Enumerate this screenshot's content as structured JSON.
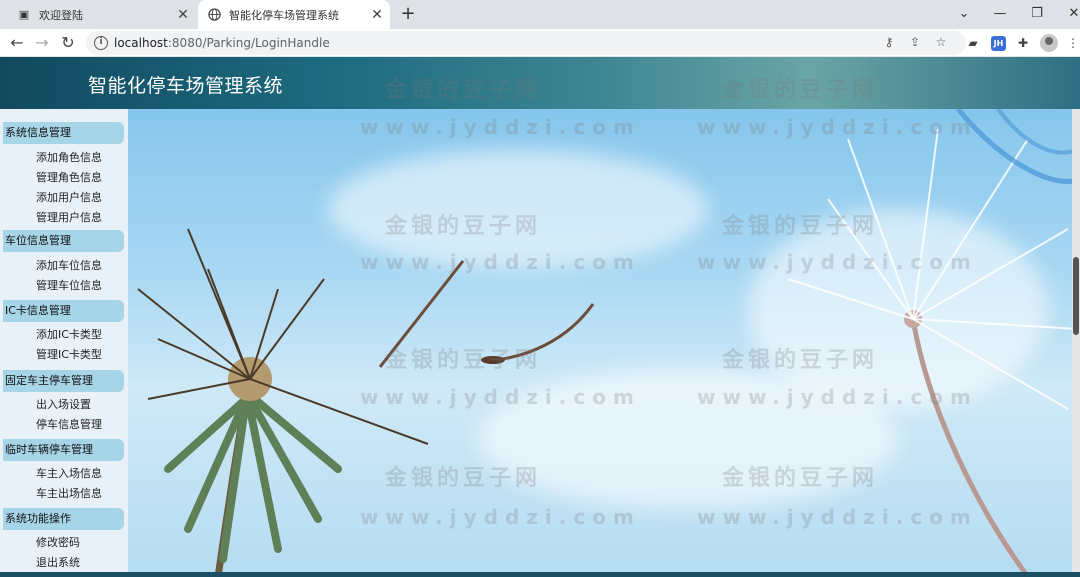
{
  "browser": {
    "tabs": [
      {
        "title": "欢迎登陆",
        "active": false
      },
      {
        "title": "智能化停车场管理系统",
        "active": true
      }
    ],
    "address": {
      "host": "localhost",
      "path": ":8080/Parking/LoginHandle"
    }
  },
  "header": {
    "title": "智能化停车场管理系统"
  },
  "sidebar": {
    "groups": [
      {
        "title": "系统信息管理",
        "items": [
          "添加角色信息",
          "管理角色信息",
          "添加用户信息",
          "管理用户信息"
        ]
      },
      {
        "title": "车位信息管理",
        "items": [
          "添加车位信息",
          "管理车位信息"
        ]
      },
      {
        "title": "IC卡信息管理",
        "items": [
          "添加IC卡类型",
          "管理IC卡类型"
        ]
      },
      {
        "title": "固定车主停车管理",
        "items": [
          "出入场设置",
          "停车信息管理"
        ]
      },
      {
        "title": "临时车辆停车管理",
        "items": [
          "车主入场信息",
          "车主出场信息"
        ]
      },
      {
        "title": "系统功能操作",
        "items": [
          "修改密码",
          "退出系统"
        ]
      }
    ]
  },
  "watermark": {
    "cn": "金银的豆子网",
    "url": "www.jyddzi.com"
  },
  "colors": {
    "header": "#1d6a7e",
    "sidebar_bg": "#e8f1f8",
    "group_bg": "#a7d5e8"
  }
}
